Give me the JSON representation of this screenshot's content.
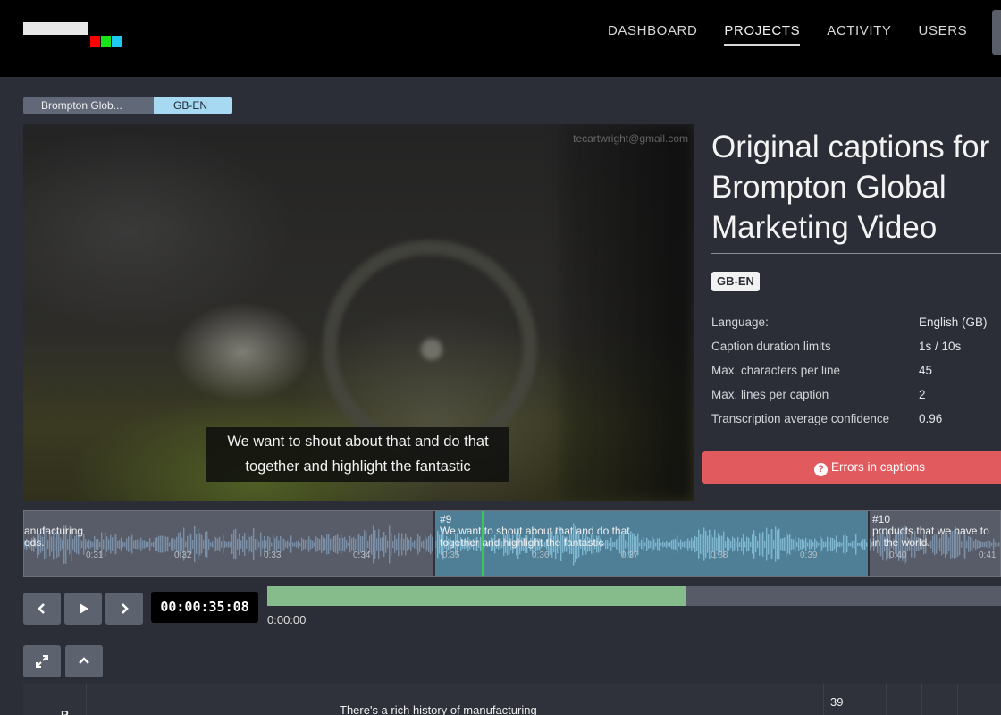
{
  "nav": {
    "items": [
      {
        "label": "DASHBOARD",
        "active": false
      },
      {
        "label": "PROJECTS",
        "active": true
      },
      {
        "label": "ACTIVITY",
        "active": false
      },
      {
        "label": "USERS",
        "active": false
      }
    ]
  },
  "breadcrumb": {
    "project": "Brompton Glob...",
    "language": "GB-EN"
  },
  "video": {
    "watermark": "tecartwright@gmail.com",
    "subtitle_line1": "We want to shout about that and do that",
    "subtitle_line2": "together and highlight the fantastic"
  },
  "info": {
    "title_line1": "Original captions for",
    "title_line2": "Brompton Global",
    "title_line3": "Marketing Video",
    "badge": "GB-EN",
    "rows": [
      {
        "label": "Language:",
        "value": "English (GB)"
      },
      {
        "label": "Caption duration limits",
        "value": "1s / 10s"
      },
      {
        "label": "Max. characters per line",
        "value": "45"
      },
      {
        "label": "Max. lines per caption",
        "value": "2"
      },
      {
        "label": "Transcription average confidence",
        "value": "0.96"
      }
    ],
    "errors_label": "Errors in captions"
  },
  "timeline": {
    "prev_caption_line1": "anufacturing",
    "prev_caption_line2": "ods.",
    "active_caption": {
      "number": "#9",
      "line1": "We want to shout about that and do that",
      "line2": "together and highlight the fantastic"
    },
    "next_caption": {
      "number": "#10",
      "line1": "products that we have to",
      "line2": "in the world."
    },
    "ticks": [
      "0:31",
      "0:32",
      "0:33",
      "0:34",
      "0:35",
      "0:36",
      "0:37",
      "0:38",
      "0:39",
      "0:40",
      "0:41"
    ]
  },
  "player": {
    "timecode": "00:00:35:08",
    "start_time": "0:00:00",
    "progress_fraction": 0.57
  },
  "caption_table": {
    "row_number": "39",
    "row_prefix": "P",
    "row_text": "There's a rich history of manufacturing"
  },
  "colors": {
    "accent_active_segment": "#4e7f97",
    "error": "#e05a5e",
    "progress": "#86bb8c",
    "breadcrumb_active": "#a7d9f3"
  }
}
